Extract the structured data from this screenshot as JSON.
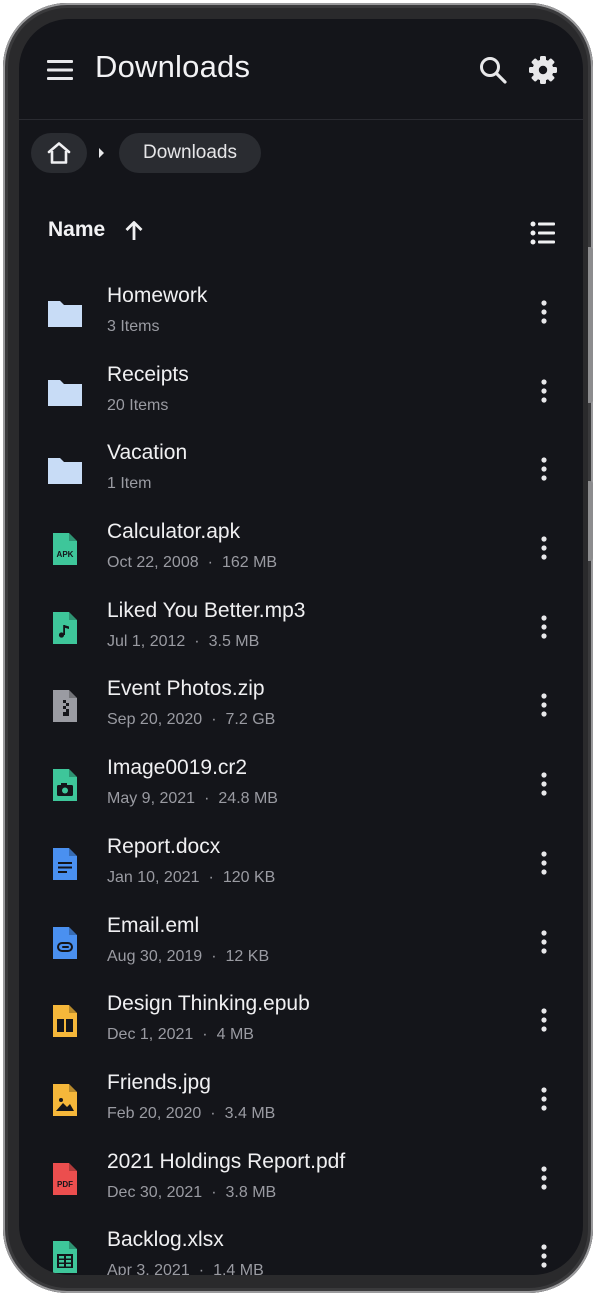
{
  "appbar": {
    "title": "Downloads",
    "icons": [
      "menu-icon",
      "search-icon",
      "gear-icon"
    ]
  },
  "breadcrumb": {
    "home_icon": "home-icon",
    "current": "Downloads"
  },
  "sort": {
    "label": "Name",
    "direction": "ascending",
    "view_toggle_icon": "list-view-icon"
  },
  "items": [
    {
      "name": "Homework",
      "kind": "folder",
      "icon": "folder-icon",
      "detail": "3 Items"
    },
    {
      "name": "Receipts",
      "kind": "folder",
      "icon": "folder-icon",
      "detail": "20 Items"
    },
    {
      "name": "Vacation",
      "kind": "folder",
      "icon": "folder-icon",
      "detail": "1 Item"
    },
    {
      "name": "Calculator.apk",
      "kind": "file",
      "icon": "apk-file-icon",
      "date": "Oct 22, 2008",
      "size": "162 MB"
    },
    {
      "name": "Liked You Better.mp3",
      "kind": "file",
      "icon": "audio-file-icon",
      "date": "Jul 1, 2012",
      "size": "3.5 MB"
    },
    {
      "name": "Event Photos.zip",
      "kind": "file",
      "icon": "zip-file-icon",
      "date": "Sep 20, 2020",
      "size": "7.2 GB"
    },
    {
      "name": "Image0019.cr2",
      "kind": "file",
      "icon": "camera-raw-file-icon",
      "date": "May 9, 2021",
      "size": "24.8 MB"
    },
    {
      "name": "Report.docx",
      "kind": "file",
      "icon": "document-file-icon",
      "date": "Jan 10, 2021",
      "size": "120 KB"
    },
    {
      "name": "Email.eml",
      "kind": "file",
      "icon": "email-file-icon",
      "date": "Aug 30, 2019",
      "size": "12 KB"
    },
    {
      "name": "Design Thinking.epub",
      "kind": "file",
      "icon": "ebook-file-icon",
      "date": "Dec 1, 2021",
      "size": "4 MB"
    },
    {
      "name": "Friends.jpg",
      "kind": "file",
      "icon": "image-file-icon",
      "date": "Feb 20, 2020",
      "size": "3.4 MB"
    },
    {
      "name": "2021 Holdings Report.pdf",
      "kind": "file",
      "icon": "pdf-file-icon",
      "date": "Dec 30, 2021",
      "size": "3.8 MB"
    },
    {
      "name": "Backlog.xlsx",
      "kind": "file",
      "icon": "spreadsheet-file-icon",
      "date": "Apr 3, 2021",
      "size": "1.4 MB"
    }
  ],
  "colors": {
    "background": "#14151a",
    "folder": "#c8dcf6",
    "apk": "#3ec69a",
    "audio": "#3ec69a",
    "zip": "#9a9ba2",
    "camera": "#3ec69a",
    "document": "#4a90f0",
    "email": "#4a90f0",
    "ebook": "#f5b73a",
    "image": "#f5b73a",
    "pdf": "#ec4e4e",
    "spreadsheet": "#3ec69a"
  }
}
